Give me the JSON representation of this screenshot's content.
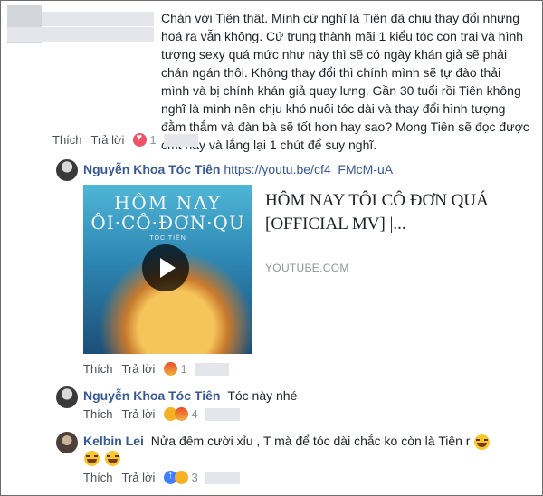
{
  "comment1": {
    "author": "",
    "text": "Chán với Tiên thật. Mình cứ nghĩ là Tiên đã chịu thay đổi nhưng hoá ra vẫn không. Cứ trung thành mãi 1 kiểu tóc con trai và hình tượng sexy quá mức như này thì sẽ có ngày khán giả sẽ phải chán ngán thôi. Không thay đổi thì chính mình sẽ tự đào thải mình và bị chính khán giả quay lưng. Gần 30 tuổi rồi Tiên không nghĩ là mình nên chịu khó nuôi tóc dài và thay đổi hình tượng đằm thắm và đàn bà sẽ tốt hơn hay sao? Mong Tiên sẽ đọc được cmt này và lắng lại 1 chút để suy nghĩ.",
    "like": "Thích",
    "reply": "Trả lời",
    "reaction_count": "1"
  },
  "reply1": {
    "author": "Nguyễn Khoa Tóc Tiên",
    "link": "https://youtu.be/cf4_FMcM-uA",
    "card_overlay_line1": "HÔM NAY",
    "card_overlay_line2": "ÔI·CÔ·ĐƠN·QU",
    "card_overlay_sub": "TÓC TIÊN",
    "card_title": "HÔM NAY TÔI CÔ ĐƠN QUÁ [OFFICIAL MV] |...",
    "card_domain": "YOUTUBE.COM",
    "like": "Thích",
    "reply": "Trả lời",
    "reaction_count": "1"
  },
  "reply2": {
    "author": "Nguyễn Khoa Tóc Tiên",
    "text": "Tóc này nhé",
    "like": "Thích",
    "reply": "Trả lời",
    "reaction_count": "4"
  },
  "reply3": {
    "author": "Kelbin Lei",
    "text": "Nửa đêm cười xỉu , T mà để tóc dài chắc ko còn là Tiên r",
    "like": "Thích",
    "reply": "Trả lời",
    "reaction_count": "3"
  }
}
